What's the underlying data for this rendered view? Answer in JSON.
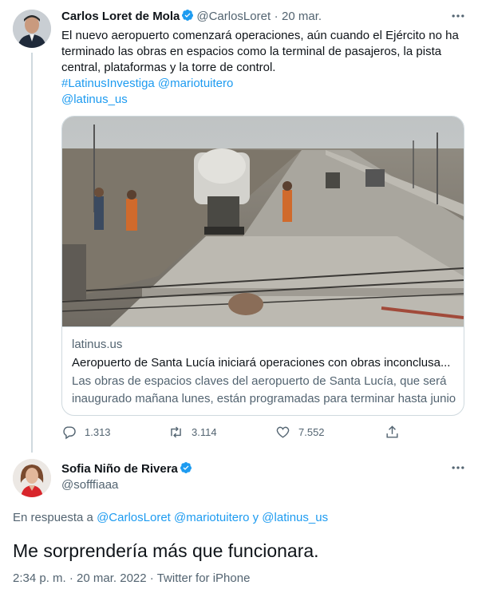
{
  "parent_tweet": {
    "author_name": "Carlos Loret de Mola",
    "author_handle": "@CarlosLoret",
    "separator": "·",
    "date": "20 mar.",
    "text_line1": "El nuevo aeropuerto comenzará operaciones, aún  cuando el Ejército no ha",
    "text_line2": "terminado las obras en espacios como la terminal de pasajeros, la pista",
    "text_line3": "central, plataformas y la torre de control.",
    "hashtag": "#LatinusInvestiga",
    "mention1": "@mariotuitero",
    "mention2": "@latinus_us",
    "card": {
      "domain": "latinus.us",
      "title": "Aeropuerto de Santa Lucía iniciará operaciones con obras inconclusa...",
      "desc_line1": "Las obras de espacios claves del aeropuerto de Santa Lucía, que será",
      "desc_line2": "inaugurado mañana lunes, están programadas para terminar hasta junio"
    },
    "actions": {
      "replies": "1.313",
      "retweets": "3.114",
      "likes": "7.552"
    }
  },
  "reply_tweet": {
    "author_name": "Sofia Niño de Rivera",
    "author_handle": "@sofffiaaa",
    "reply_prefix": "En respuesta a",
    "reply_mention1": "@CarlosLoret",
    "reply_mention2": "@mariotuitero",
    "reply_and": "y",
    "reply_mention3": "@latinus_us",
    "text": "Me sorprendería más que funcionara.",
    "time": "2:34 p. m.",
    "dot": "·",
    "date": "20 mar. 2022",
    "source": "Twitter for iPhone"
  },
  "icons": [
    "verified-icon",
    "more-icon",
    "reply-icon",
    "retweet-icon",
    "like-icon",
    "share-icon"
  ],
  "colors": {
    "accent": "#1d9bf0",
    "secondary_text": "#536471",
    "border": "#cfd9de"
  }
}
